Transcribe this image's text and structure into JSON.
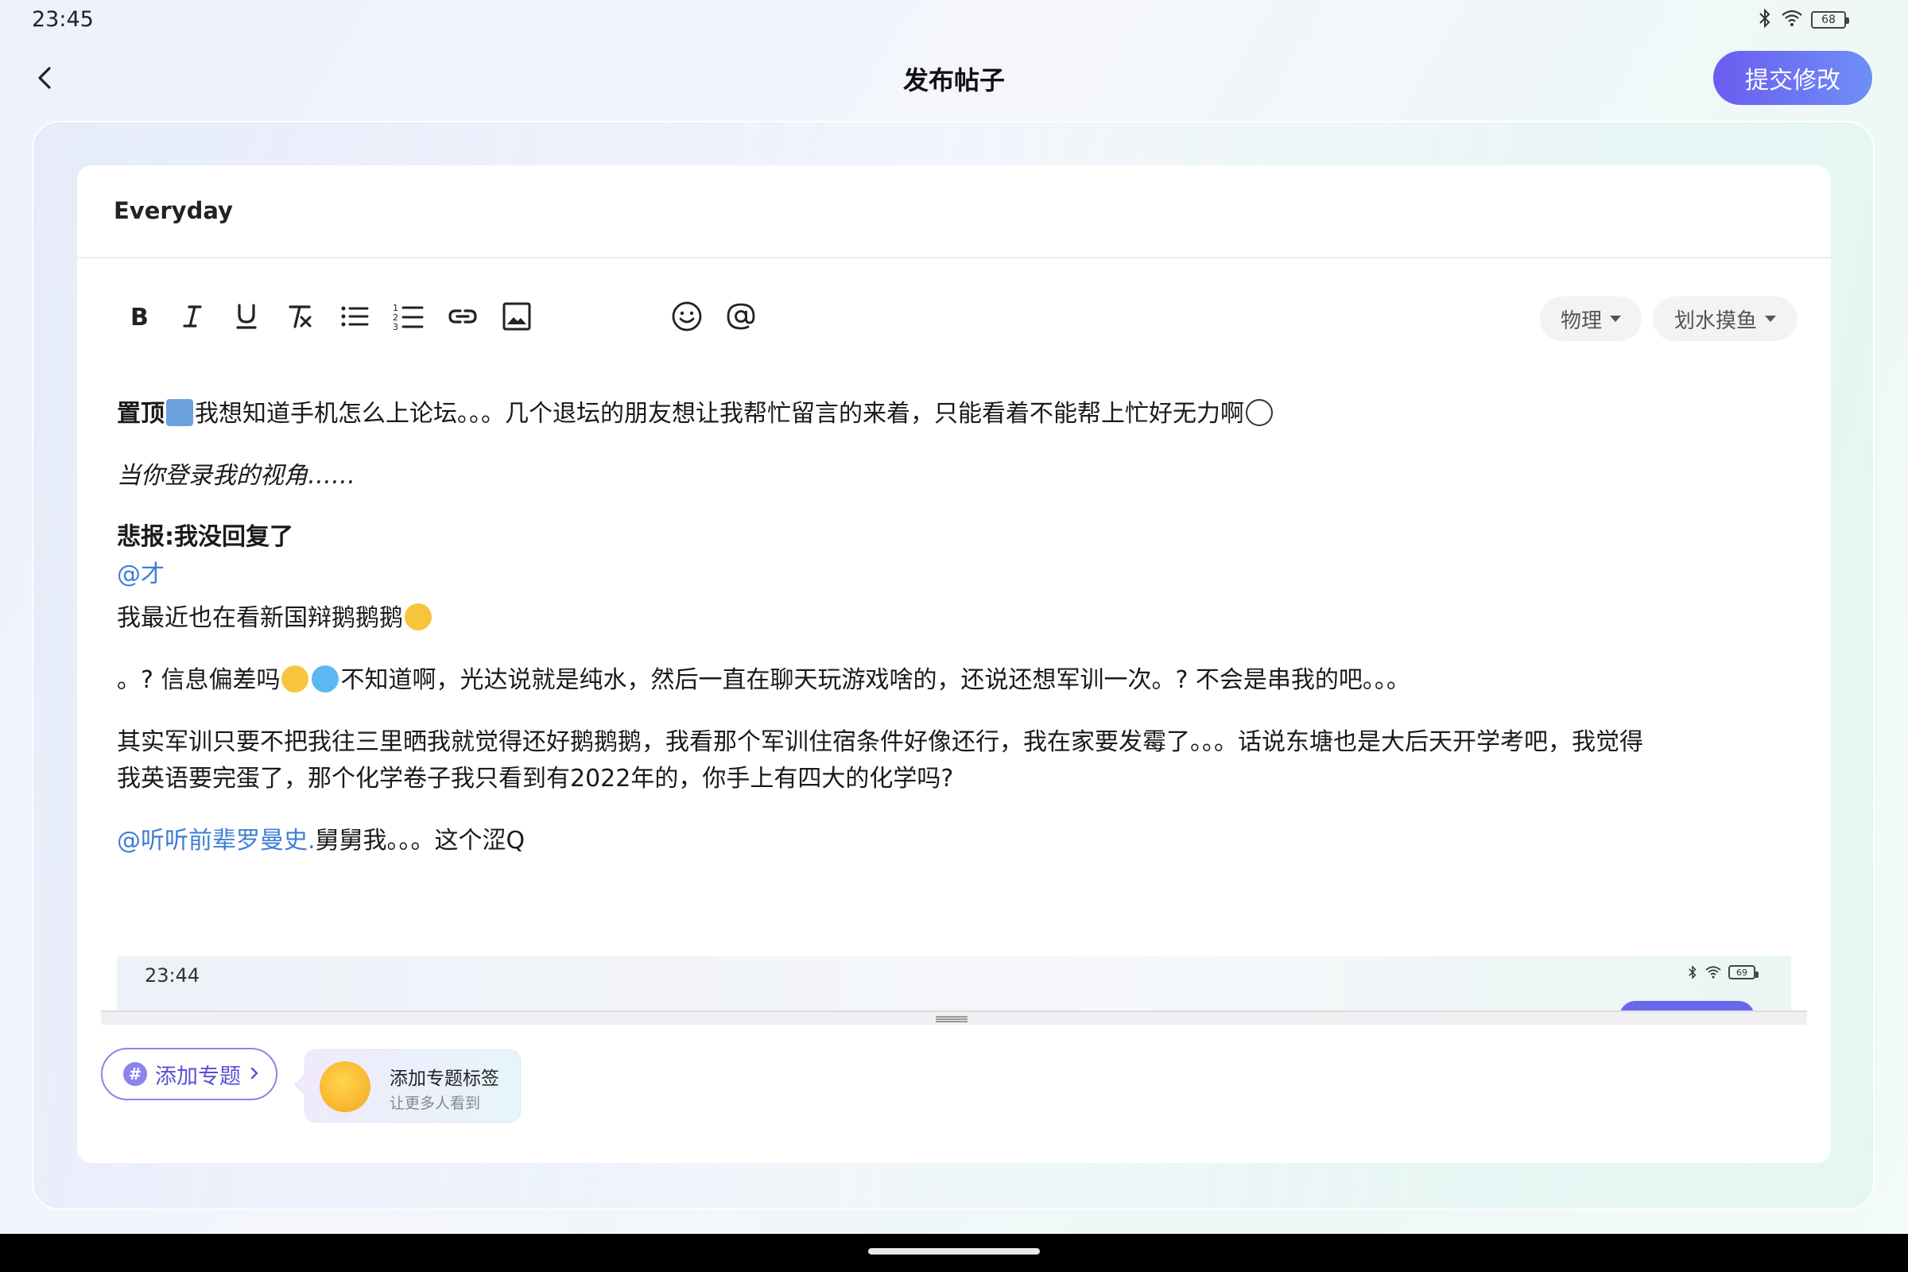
{
  "status_bar": {
    "time": "23:45",
    "battery": "68",
    "icons": [
      "bluetooth-icon",
      "wifi-icon",
      "battery-icon"
    ]
  },
  "header": {
    "title": "发布帖子",
    "submit_label": "提交修改",
    "back_icon": "chevron-left-icon"
  },
  "editor": {
    "post_title": "Everyday",
    "toolbar": {
      "format_buttons": [
        "bold",
        "italic",
        "underline",
        "clear-format",
        "bullet-list",
        "numbered-list",
        "link",
        "image"
      ],
      "extra_buttons": [
        "emoji",
        "mention"
      ],
      "category_label": "物理",
      "subforum_label": "划水摸鱼"
    },
    "content": {
      "p1_bold": "置顶",
      "p1_text": "我想知道手机怎么上论坛。。。几个退坛的朋友想让我帮忙留言的来着，只能看着不能帮上忙好无力啊",
      "p2_italic": "当你登录我的视角……",
      "p3_bold": "悲报:我没回复了",
      "p4_mention": "@才",
      "p5_text": "我最近也在看新国辩鹅鹅鹅",
      "p6_a": "。?  信息偏差吗",
      "p6_b": "不知道啊，光达说就是纯水，然后一直在聊天玩游戏啥的，还说还想军训一次。?  不会是串我的吧。。。",
      "p7_line1": "其实军训只要不把我往三里晒我就觉得还好鹅鹅鹅，我看那个军训住宿条件好像还行，我在家要发霉了。。。话说东塘也是大后天开学考吧，我觉得",
      "p7_line2": "我英语要完蛋了，那个化学卷子我只看到有2022年的，你手上有四大的化学吗?",
      "p8_mention": "@听听前辈罗曼史.",
      "p8_text": "舅舅我。。。这个涩Q"
    },
    "preview": {
      "time": "23:44",
      "battery": "69"
    }
  },
  "topic": {
    "add_label": "添加专题",
    "tip_title": "添加专题标签",
    "tip_subtitle": "让更多人看到"
  },
  "colors": {
    "accent": "#6b5cf0",
    "mention": "#3d7fd6"
  }
}
